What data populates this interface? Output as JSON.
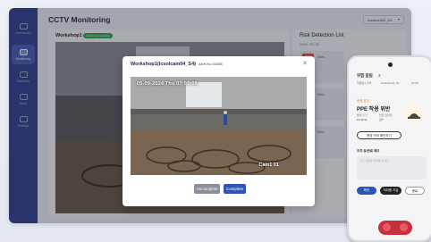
{
  "app": {
    "title": "CCTV Monitoring",
    "site_select": "Icsolcam04_S4"
  },
  "sidebar": {
    "items": [
      {
        "label": "Dashboard",
        "active": false
      },
      {
        "label": "Monitoring",
        "active": true
      },
      {
        "label": "Statistics",
        "active": false
      },
      {
        "label": "Work",
        "active": false
      },
      {
        "label": "Settings",
        "active": false
      }
    ]
  },
  "workshop": {
    "name": "Workshop1",
    "status": "Monitoring Available"
  },
  "risk": {
    "title": "Risk Detection List",
    "date": "2024. 05. 09",
    "items": [
      {
        "badge": "Risk",
        "text": "Wor..."
      },
      {
        "badge": "Risk",
        "text": "Wor..."
      },
      {
        "badge": "Risk",
        "text": "Wor..."
      }
    ]
  },
  "modal": {
    "title": "Workshop1(Icsolcam04_S4)",
    "alert_id": "Alert No 00458",
    "timestamp": "05-09-2024  Thu  07:57:08",
    "camera_label": "Cam1 01",
    "uncomplete_label": "Uncomplete",
    "complete_label": "Complete"
  },
  "phone": {
    "header": "위험 알림",
    "count": "3",
    "meta": [
      "작업장1 구역",
      "Icsolcam04_S4",
      "12:55"
    ],
    "risk_label": "위험 감지",
    "ppe": "PPE 착용 위반",
    "details": [
      "발생 시각",
      "10:49:11",
      "현장 담당자",
      "김**"
    ],
    "action": "현장 관리 확인하기",
    "memo_title": "조치 중/완료 메모",
    "memo_placeholder": "조치 내용을 입력해 주세요.",
    "buttons": [
      "확인",
      "처리중 기입",
      "종료"
    ]
  },
  "colors": {
    "sidebar": "#2f3f8f",
    "primary": "#2f55b4",
    "danger": "#c7303c",
    "ok": "#2ea650"
  }
}
